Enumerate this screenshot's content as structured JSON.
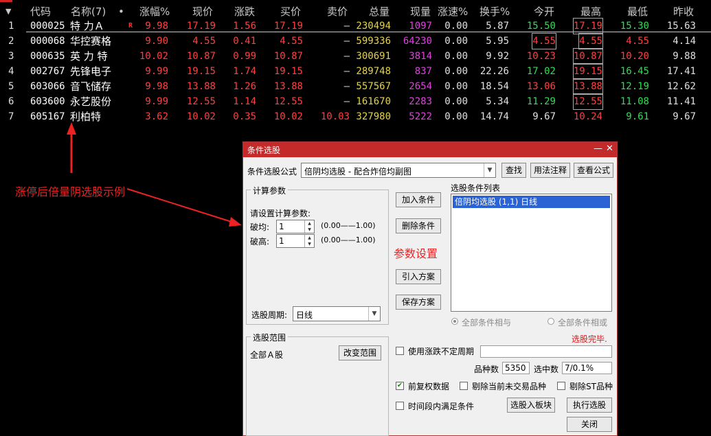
{
  "headers": {
    "code": "代码",
    "name": "名称(7)",
    "dot": "•",
    "pct": "涨幅%",
    "price": "现价",
    "chg": "涨跌",
    "bid": "买价",
    "ask": "卖价",
    "vol": "总量",
    "cur": "现量",
    "speed": "涨速%",
    "turn": "换手%",
    "open": "今开",
    "high": "最高",
    "low": "最低",
    "prev": "昨收"
  },
  "rows": [
    {
      "idx": "1",
      "code": "000025",
      "name": "特 力Ａ",
      "flag": "R",
      "pct": "9.98",
      "price": "17.19",
      "chg": "1.56",
      "bid": "17.19",
      "ask": "—",
      "vol": "230494",
      "cur": "1097",
      "speed": "0.00",
      "turn": "5.87",
      "open": "15.50",
      "high": "17.19",
      "low": "15.30",
      "prev": "15.63"
    },
    {
      "idx": "2",
      "code": "000068",
      "name": "华控赛格",
      "flag": "",
      "pct": "9.90",
      "price": "4.55",
      "chg": "0.41",
      "bid": "4.55",
      "ask": "—",
      "vol": "599336",
      "cur": "64230",
      "speed": "0.00",
      "turn": "5.95",
      "open": "4.55",
      "high": "4.55",
      "low": "4.55",
      "prev": "4.14"
    },
    {
      "idx": "3",
      "code": "000635",
      "name": "英 力 特",
      "flag": "",
      "pct": "10.02",
      "price": "10.87",
      "chg": "0.99",
      "bid": "10.87",
      "ask": "—",
      "vol": "300691",
      "cur": "3814",
      "speed": "0.00",
      "turn": "9.92",
      "open": "10.23",
      "high": "10.87",
      "low": "10.20",
      "prev": "9.88"
    },
    {
      "idx": "4",
      "code": "002767",
      "name": "先锋电子",
      "flag": "",
      "pct": "9.99",
      "price": "19.15",
      "chg": "1.74",
      "bid": "19.15",
      "ask": "—",
      "vol": "289748",
      "cur": "837",
      "speed": "0.00",
      "turn": "22.26",
      "open": "17.02",
      "high": "19.15",
      "low": "16.45",
      "prev": "17.41"
    },
    {
      "idx": "5",
      "code": "603066",
      "name": "音飞储存",
      "flag": "",
      "pct": "9.98",
      "price": "13.88",
      "chg": "1.26",
      "bid": "13.88",
      "ask": "—",
      "vol": "557567",
      "cur": "2654",
      "speed": "0.00",
      "turn": "18.54",
      "open": "13.06",
      "high": "13.88",
      "low": "12.19",
      "prev": "12.62"
    },
    {
      "idx": "6",
      "code": "603600",
      "name": "永艺股份",
      "flag": "",
      "pct": "9.99",
      "price": "12.55",
      "chg": "1.14",
      "bid": "12.55",
      "ask": "—",
      "vol": "161670",
      "cur": "2283",
      "speed": "0.00",
      "turn": "5.34",
      "open": "11.29",
      "high": "12.55",
      "low": "11.08",
      "prev": "11.41"
    },
    {
      "idx": "7",
      "code": "605167",
      "name": "利柏特",
      "flag": "",
      "pct": "3.62",
      "price": "10.02",
      "chg": "0.35",
      "bid": "10.02",
      "ask": "10.03",
      "vol": "327980",
      "cur": "5222",
      "speed": "0.00",
      "turn": "14.74",
      "open": "9.67",
      "high": "10.24",
      "low": "9.61",
      "prev": "9.67"
    }
  ],
  "annotations": {
    "example": "涨停后倍量阴选股示例",
    "param": "参数设置"
  },
  "dialog": {
    "title": "条件选股",
    "formula_label": "条件选股公式",
    "formula_value": "倍阴均选股  -  配合炸倍均副图",
    "find": "查找",
    "usage": "用法注释",
    "view": "查看公式",
    "calc_group": "计算参数",
    "calc_prompt": "请设置计算参数:",
    "param1_label": "破均:",
    "param1_value": "1",
    "param1_range": "(0.00——1.00)",
    "param2_label": "破高:",
    "param2_value": "1",
    "param2_range": "(0.00——1.00)",
    "period_label": "选股周期:",
    "period_value": "日线",
    "add": "加入条件",
    "delete": "删除条件",
    "import": "引入方案",
    "save": "保存方案",
    "list_label": "选股条件列表",
    "list_item": "倍阴均选股 (1,1) 日线",
    "radio_and": "全部条件相与",
    "radio_or": "全部条件相或",
    "status": "选股完毕.",
    "range_group": "选股范围",
    "range_value": "全部Ａ股",
    "change_range": "改变范围",
    "use_period": "使用涨跌不定周期",
    "count_label": "品种数",
    "count_value": "5350",
    "selected_label": "选中数",
    "selected_value": "7/0.1%",
    "cb_fq": "前复权数据",
    "cb_untraded": "剔除当前未交易品种",
    "cb_st": "剔除ST品种",
    "cb_time": "时间段内满足条件",
    "to_block": "选股入板块",
    "execute": "执行选股",
    "close": "关闭"
  },
  "colors": {
    "up": "#ff4040",
    "down": "#33dd55",
    "volume": "#e6d34a",
    "current": "#e040e0",
    "title_bar": "#c42a2a"
  }
}
